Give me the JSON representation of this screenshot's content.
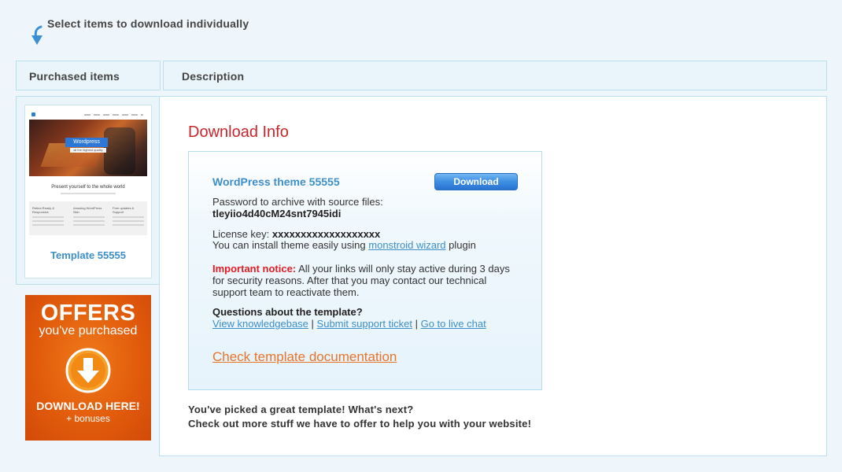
{
  "hint": {
    "text": "Select items to download individually",
    "icon": "arrow-down-icon"
  },
  "table": {
    "col_items": "Purchased items",
    "col_description": "Description"
  },
  "item": {
    "name": "Template 55555",
    "thumbnail": {
      "badge": "Wordpress Theme",
      "badge_sub": "all the highest quality",
      "tagline": "Present yourself to the whole world",
      "columns": [
        "Retina Ready & Responsive",
        "Amazing WordPress Skin",
        "Free updates & Support"
      ]
    }
  },
  "offers": {
    "title": "OFFERS",
    "subtitle": "you've purchased",
    "cta": "DOWNLOAD HERE!",
    "bonus": "+ bonuses",
    "icon": "download-circle-icon"
  },
  "download": {
    "heading": "Download Info",
    "theme_name": "WordPress theme 55555",
    "button": "Download",
    "password_label": "Password to archive with source files:",
    "password_value": "tleyiio4d40cM24snt7945idi",
    "license_label": "License key:",
    "license_value": "xxxxxxxxxxxxxxxxxxx",
    "install_prefix": "You can install theme easily using",
    "install_link": "monstroid wizard",
    "install_suffix": "plugin",
    "notice_label": "Important notice:",
    "notice_text": "All your links will only stay active during 3 days for security reasons. After that you may contact our technical support team to reactivate them.",
    "questions_label": "Questions about the template?",
    "links": [
      "View knowledgebase",
      "Submit support ticket",
      "Go to live chat"
    ],
    "separator": "|",
    "doc_link": "Check template documentation"
  },
  "next": {
    "line1": "You've picked a great template! What's next?",
    "line2": "Check out more stuff we have to offer to help you with your website!"
  },
  "colors": {
    "accent_blue": "#3d8fc9",
    "heading_red": "#c8262b",
    "notice_red": "#e21d24",
    "doc_orange": "#e8742c",
    "offers_orange": "#e25c0c"
  }
}
